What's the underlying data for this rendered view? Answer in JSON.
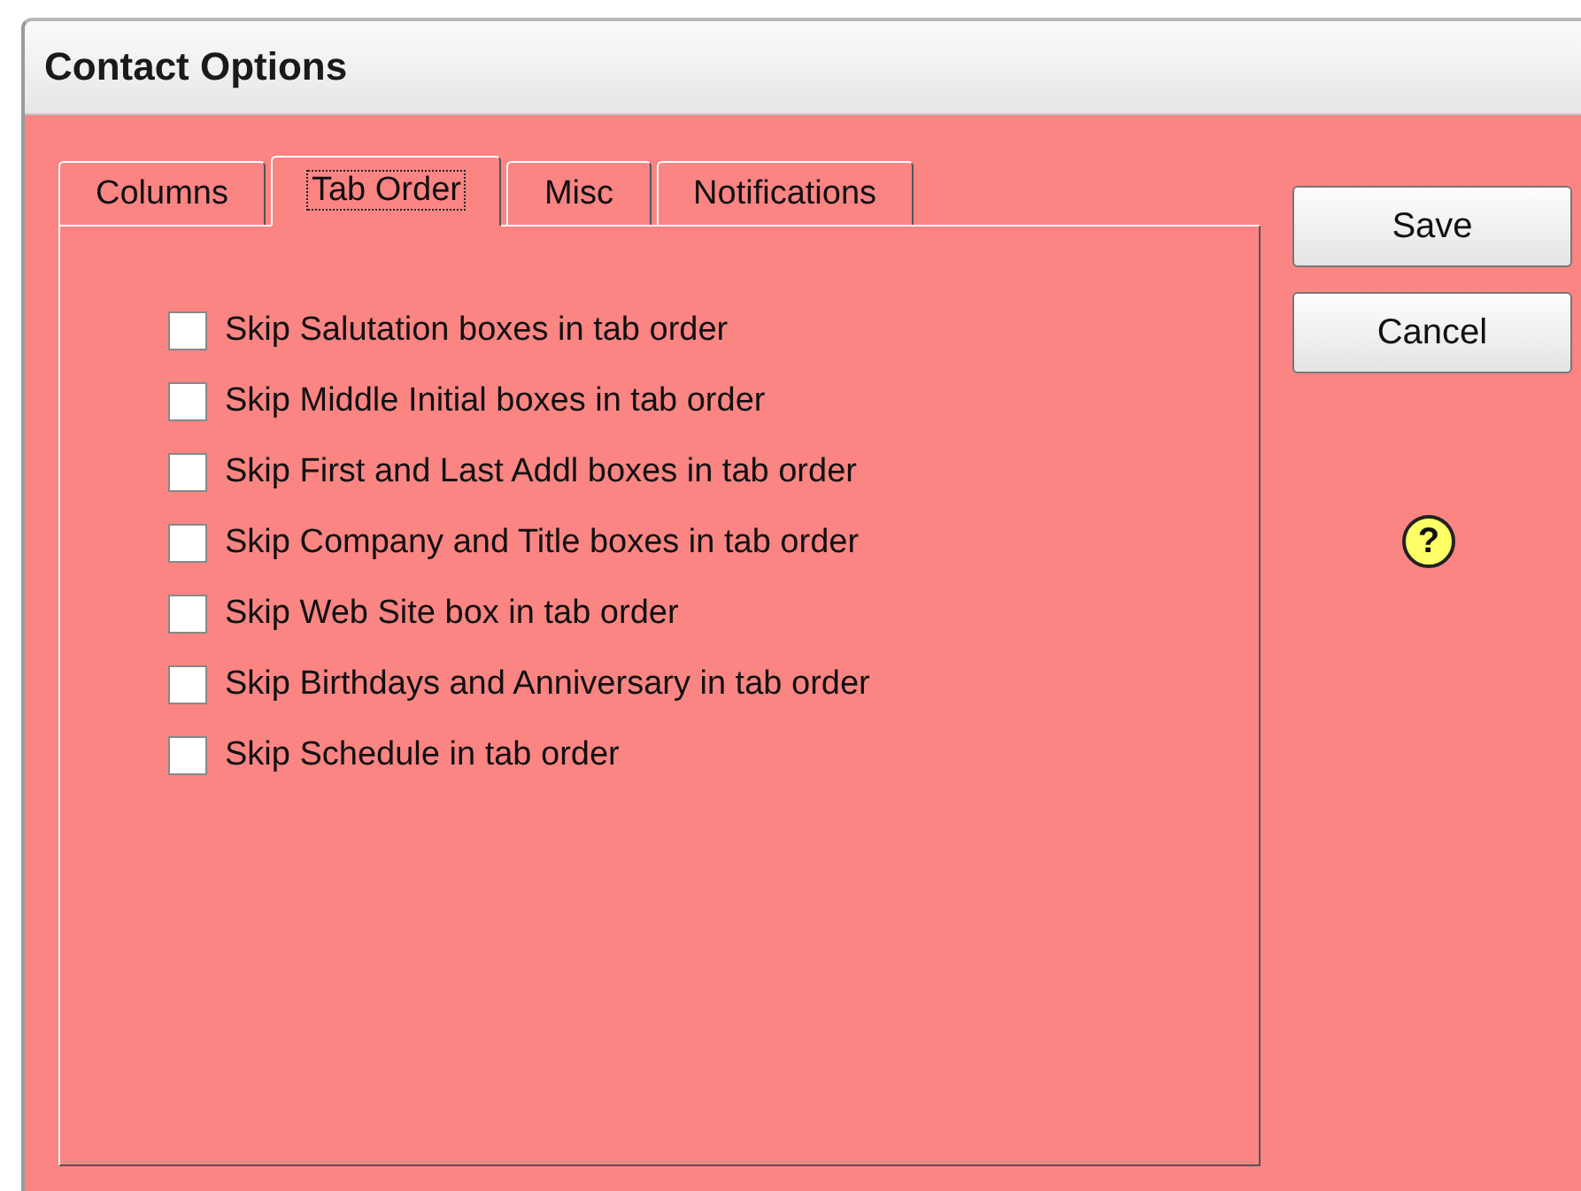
{
  "window": {
    "title": "Contact Options"
  },
  "tabs": [
    {
      "label": "Columns",
      "selected": false
    },
    {
      "label": "Tab Order",
      "selected": true
    },
    {
      "label": "Misc",
      "selected": false
    },
    {
      "label": "Notifications",
      "selected": false
    }
  ],
  "options": [
    {
      "label": "Skip Salutation boxes in tab order",
      "checked": false
    },
    {
      "label": "Skip Middle Initial boxes in tab order",
      "checked": false
    },
    {
      "label": "Skip First and Last Addl boxes in tab order",
      "checked": false
    },
    {
      "label": "Skip Company and Title boxes in tab order",
      "checked": false
    },
    {
      "label": "Skip Web Site box in tab order",
      "checked": false
    },
    {
      "label": "Skip Birthdays and Anniversary in tab order",
      "checked": false
    },
    {
      "label": "Skip Schedule in tab order",
      "checked": false
    }
  ],
  "buttons": [
    "Save",
    "Cancel"
  ],
  "help": {
    "symbol": "?"
  }
}
